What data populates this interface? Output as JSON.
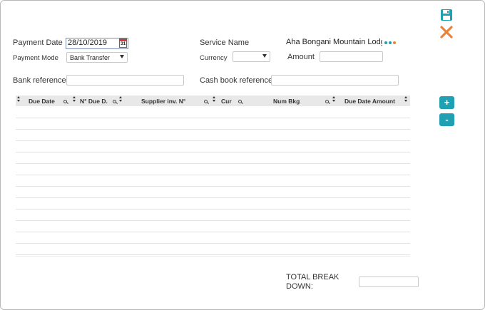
{
  "toolbar": {
    "save_icon": "floppy-disk-icon",
    "close_icon": "close-x-icon",
    "save_color": "#1fa0b3",
    "close_color": "#e8833a"
  },
  "form": {
    "payment_date_label": "Payment Date",
    "payment_date_value": "28/10/2019",
    "calendar_icon": "calendar-icon",
    "calendar_day": "31",
    "payment_mode_label": "Payment Mode",
    "payment_mode_value": "Bank Transfer",
    "service_name_label": "Service Name",
    "service_name_value": "Aha Bongani Mountain Lodge",
    "currency_label": "Currency",
    "currency_value": "",
    "amount_label": "Amount",
    "amount_value": "",
    "bank_reference_label": "Bank reference:",
    "bank_reference_value": "",
    "cash_book_reference_label": "Cash book reference:",
    "cash_book_reference_value": ""
  },
  "grid": {
    "columns": [
      "Due Date",
      "N° Due D.",
      "Supplier inv. N°",
      "Cur",
      "Num Bkg",
      "Due Date Amount"
    ],
    "row_count": 14
  },
  "side_buttons": {
    "add": "+",
    "remove": "-"
  },
  "footer": {
    "total_label_line1": "TOTAL BREAK",
    "total_label_line2": "DOWN:",
    "total_value": ""
  }
}
